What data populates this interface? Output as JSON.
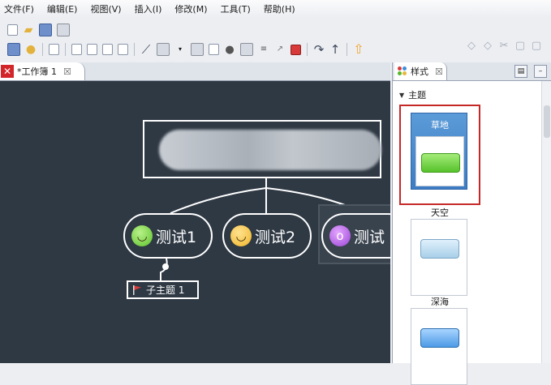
{
  "menubar": {
    "items": [
      "文件(F)",
      "编辑(E)",
      "视图(V)",
      "插入(I)",
      "修改(M)",
      "工具(T)",
      "帮助(H)"
    ]
  },
  "toolbar": {
    "row1_icons": [
      "new-file-icon",
      "open-folder-icon",
      "save-icon",
      "print-icon"
    ],
    "row2_icons": [
      "topic-icon",
      "idea-bulb-icon",
      "export-icon",
      "subtopic-icon",
      "topic-before-icon",
      "topic-after-icon",
      "callout-icon",
      "relationship-icon",
      "image-icon",
      "dropdown-icon",
      "boundary-icon",
      "note-icon",
      "marker-icon",
      "summary-icon",
      "align-icon",
      "label-icon",
      "stop-icon",
      "undo-arrow-icon",
      "redo-arrow-icon",
      "drill-up-icon"
    ],
    "right_icons": [
      "back-icon",
      "forward-icon",
      "cut-icon",
      "copy-icon",
      "paste-icon"
    ]
  },
  "editor": {
    "tab_label": "*工作簿 1",
    "tab_close": "☒"
  },
  "mindmap": {
    "central_topic": "",
    "main_topics": [
      {
        "label": "测试1",
        "marker": "smiley-icon"
      },
      {
        "label": "测试2",
        "marker": "laugh-icon"
      },
      {
        "label": "测试",
        "marker": "surprised-icon"
      }
    ],
    "subtopic": {
      "label": "子主题 1",
      "marker": "red-flag-icon"
    }
  },
  "colors": {
    "canvas_bg": "#2f3944",
    "topic_border": "#ffffff",
    "selection_red": "#c62828",
    "selected_style_blue": "#4a8bd0"
  },
  "style_panel": {
    "tab_label": "样式",
    "tab_close": "☒",
    "section_title": "主题",
    "styles": [
      {
        "name": "草地",
        "selected": true
      },
      {
        "name": "天空",
        "selected": false
      },
      {
        "name": "深海",
        "selected": false
      }
    ]
  }
}
